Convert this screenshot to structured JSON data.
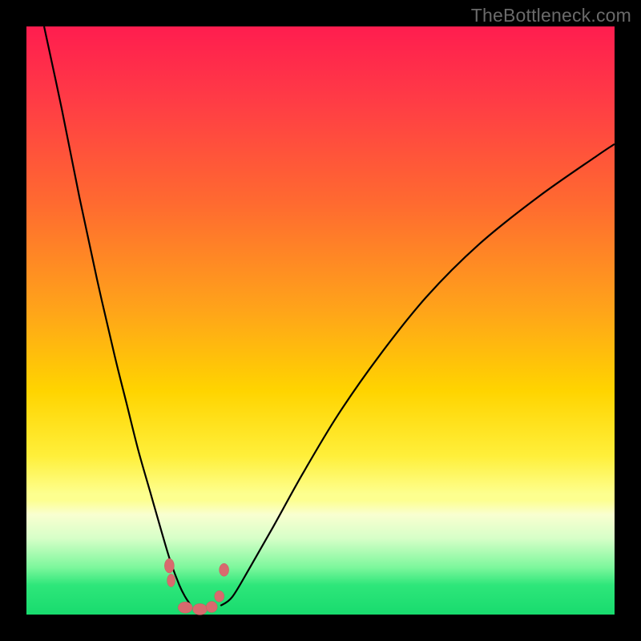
{
  "watermark": "TheBottleneck.com",
  "chart_data": {
    "type": "line",
    "title": "",
    "xlabel": "",
    "ylabel": "",
    "xlim": [
      0,
      100
    ],
    "ylim": [
      0,
      100
    ],
    "grid": false,
    "legend": false,
    "series": [
      {
        "name": "left-curve",
        "x": [
          3,
          6,
          9,
          12,
          15,
          17,
          19,
          21,
          23,
          24.5,
          26,
          27,
          28
        ],
        "values": [
          100,
          86,
          71,
          57,
          44,
          36,
          28,
          21,
          14,
          9,
          5,
          3,
          1.5
        ]
      },
      {
        "name": "right-curve",
        "x": [
          33,
          35,
          38,
          42,
          47,
          53,
          60,
          68,
          77,
          87,
          97,
          100
        ],
        "values": [
          1.5,
          3,
          8,
          15,
          24,
          34,
          44,
          54,
          63,
          71,
          78,
          80
        ]
      }
    ],
    "floor_band": {
      "y0": 0,
      "y1": 19,
      "colors_top_to_bottom": [
        "#fdff8f",
        "#f9ffd0",
        "#d7ffc8",
        "#7cf79c",
        "#2ee67a",
        "#18db6e"
      ]
    },
    "marker_cluster": {
      "approx_x_range": [
        24,
        34
      ],
      "approx_y_range": [
        0,
        9
      ],
      "color": "#d86a6e"
    },
    "colors": {
      "curve": "#000000",
      "background_top": "#ff1d4f",
      "background_mid": "#ffd400",
      "background_bottom": "#18db6e",
      "frame": "#000000"
    }
  }
}
